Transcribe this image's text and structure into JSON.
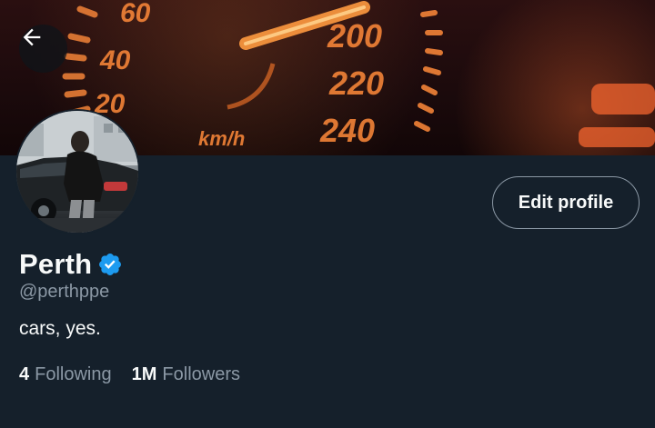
{
  "banner": {
    "gauge_labels": [
      "60",
      "40",
      "20",
      "200",
      "220",
      "240",
      "km/h"
    ]
  },
  "header": {
    "back_icon": "arrow-left-icon"
  },
  "profile": {
    "display_name": "Perth",
    "verified_icon": "verified-badge-icon",
    "handle": "@perthppe",
    "bio": "cars, yes.",
    "edit_button_label": "Edit profile",
    "stats": {
      "following_count": "4",
      "following_label": "Following",
      "followers_count": "1M",
      "followers_label": "Followers"
    }
  },
  "colors": {
    "background": "#15202b",
    "primary_text": "#f7f9f9",
    "secondary_text": "#8b98a5",
    "verified_blue": "#1d9bf0",
    "gauge_orange": "#ff7a2a"
  }
}
